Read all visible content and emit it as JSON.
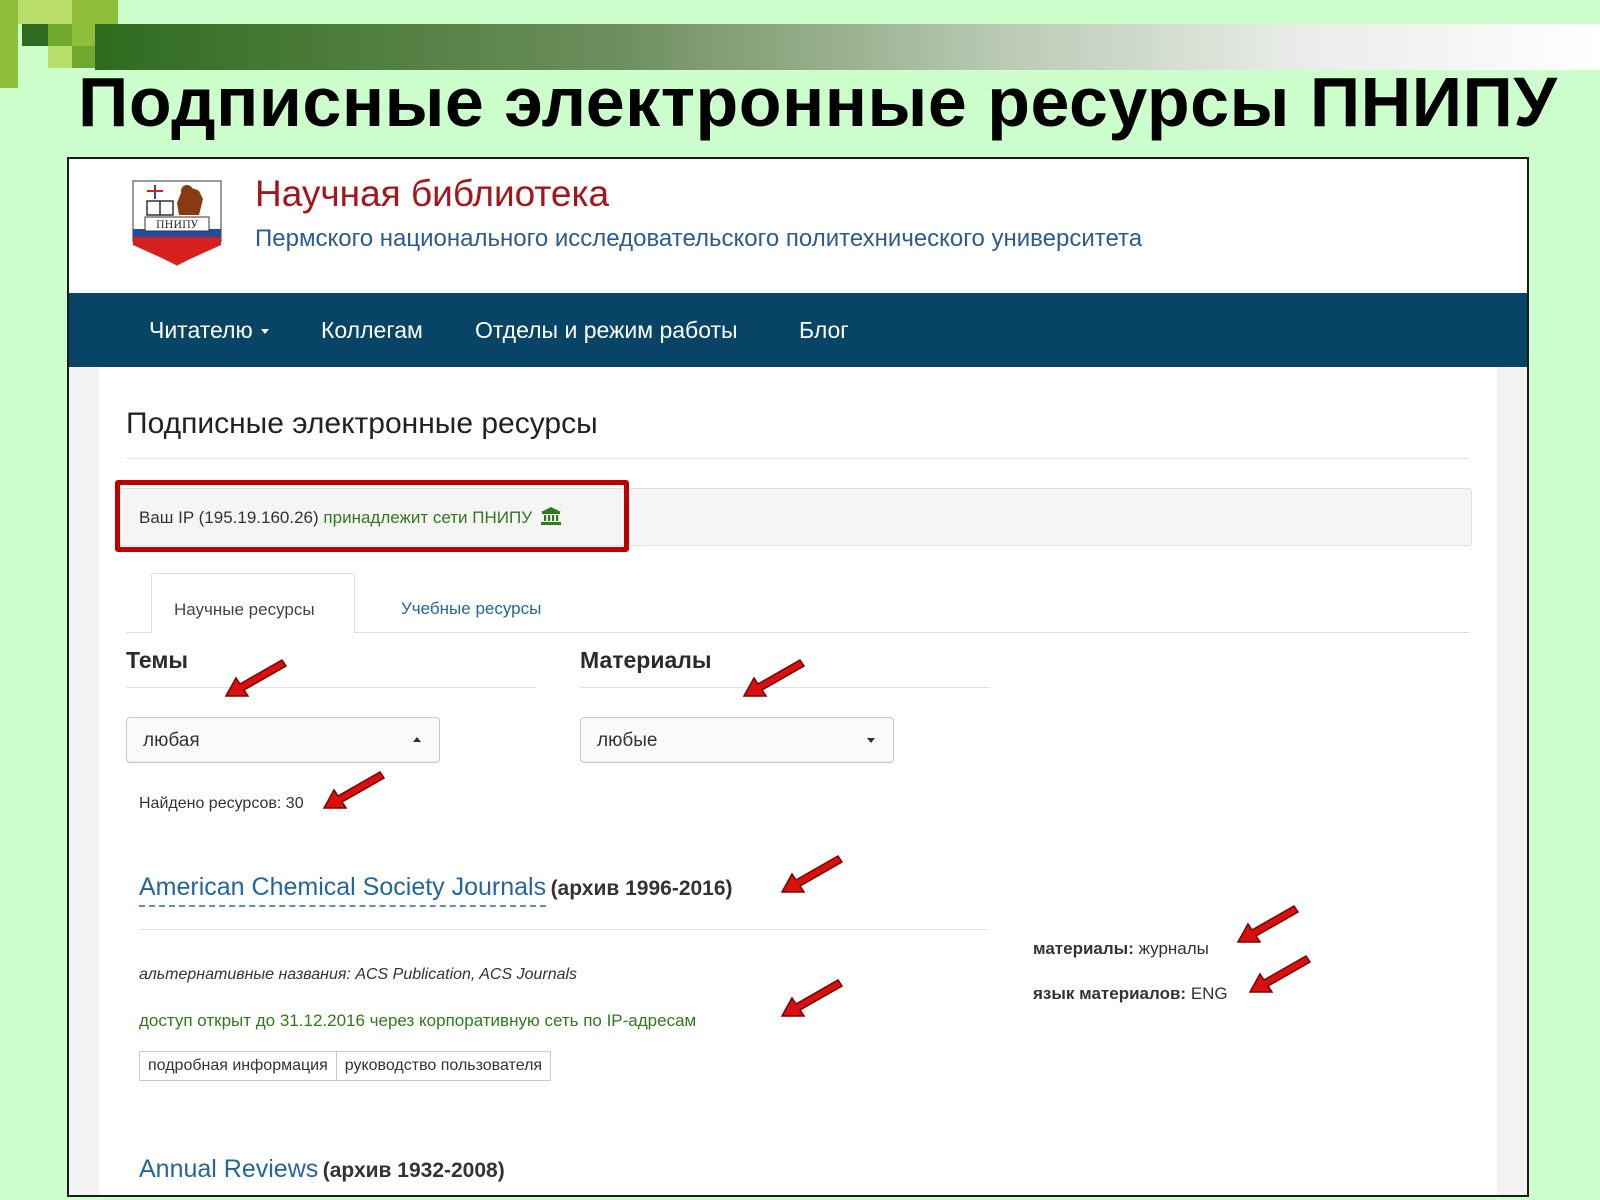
{
  "slide": {
    "title": "Подписные электронные ресурсы ПНИПУ",
    "colors": {
      "background": "#ccffcc",
      "title": "#000000"
    }
  },
  "site": {
    "logo_text": "ПНИПУ",
    "title": "Научная библиотека",
    "subtitle": "Пермского национального исследовательского политехнического университета",
    "colors": {
      "title": "#a3171b",
      "subtitle": "#2a5c8f",
      "navbar": "#084466"
    }
  },
  "nav": {
    "items": [
      {
        "label": "Читателю",
        "has_dropdown": true
      },
      {
        "label": "Коллегам"
      },
      {
        "label": "Отделы и режим работы"
      },
      {
        "label": "Блог"
      }
    ]
  },
  "page": {
    "title": "Подписные электронные ресурсы",
    "ip_notice": {
      "prefix": "Ваш IP (195.19.160.26)",
      "status": "принадлежит сети ПНИПУ",
      "icon": "bank-icon"
    },
    "tabs": [
      {
        "label": "Научные ресурсы",
        "active": true
      },
      {
        "label": "Учебные ресурсы",
        "active": false
      }
    ],
    "filters": {
      "topics": {
        "label": "Темы",
        "value": "любая"
      },
      "materials": {
        "label": "Материалы",
        "value": "любые"
      }
    },
    "found_count": "Найдено ресурсов: 30",
    "resources": [
      {
        "name": "American Chemical Society Journals",
        "archive": "(архив 1996-2016)",
        "alt_names": "альтернативные названия: ACS Publication, ACS Journals",
        "access": "доступ открыт до 31.12.2016 через корпоративную сеть по IP-адресам",
        "buttons": [
          "подробная информация",
          "руководство пользователя"
        ],
        "materials_label": "материалы:",
        "materials_value": "журналы",
        "language_label": "язык материалов:",
        "language_value": "ENG"
      },
      {
        "name": "Annual Reviews",
        "archive": "(архив 1932-2008)"
      }
    ]
  },
  "annotations": {
    "arrow_color": "#d81010"
  }
}
